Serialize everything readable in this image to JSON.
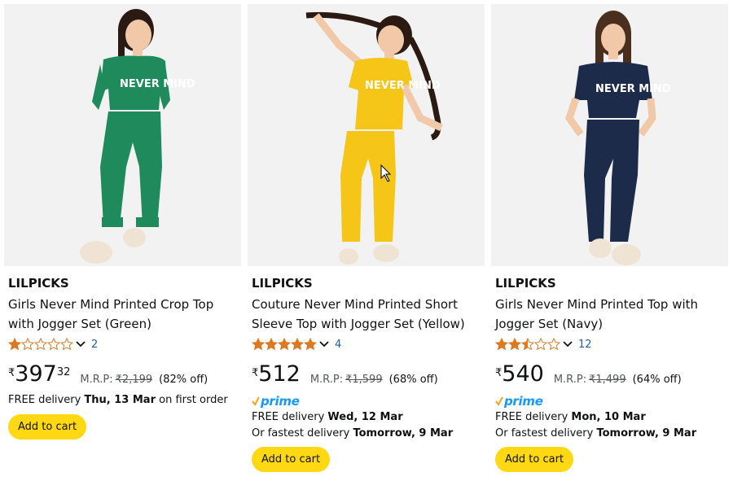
{
  "accent_colors": {
    "star": "#de7921",
    "link": "#2162a1",
    "button": "#ffd814",
    "prime": "#1399ff"
  },
  "products": [
    {
      "brand": "LILPICKS",
      "title": "Girls Never Mind Printed Crop Top with Jogger Set (Green)",
      "rating": 1,
      "rating_count": "2",
      "currency": "₹",
      "price_whole": "397",
      "price_fraction": "32",
      "mrp_label": "M.R.P:",
      "mrp": "₹2,199",
      "discount": "(82% off)",
      "prime": false,
      "delivery_prefix": "FREE delivery ",
      "delivery_date": "Thu, 13 Mar",
      "delivery_suffix": " on first order",
      "add_to_cart": "Add to cart",
      "outfit_color": "#1f8a5c",
      "print_text": "NEVER MIND"
    },
    {
      "brand": "LILPICKS",
      "title": "Couture Never Mind Printed Short Sleeve Top with Jogger Set (Yellow)",
      "rating": 5,
      "rating_count": "4",
      "currency": "₹",
      "price_whole": "512",
      "price_fraction": "",
      "mrp_label": "M.R.P:",
      "mrp": "₹1,599",
      "discount": "(68% off)",
      "prime": true,
      "prime_label": "prime",
      "delivery_prefix": "FREE delivery ",
      "delivery_date": "Wed, 12 Mar",
      "fastest_prefix": "Or fastest delivery ",
      "fastest_date": "Tomorrow, 9 Mar",
      "add_to_cart": "Add to cart",
      "outfit_color": "#f5c518",
      "print_text": "NEVER MIND"
    },
    {
      "brand": "LILPICKS",
      "title": "Girls Never Mind Printed Top with Jogger Set (Navy)",
      "rating": 2.5,
      "rating_count": "12",
      "currency": "₹",
      "price_whole": "540",
      "price_fraction": "",
      "mrp_label": "M.R.P:",
      "mrp": "₹1,499",
      "discount": "(64% off)",
      "prime": true,
      "prime_label": "prime",
      "delivery_prefix": "FREE delivery ",
      "delivery_date": "Mon, 10 Mar",
      "fastest_prefix": "Or fastest delivery ",
      "fastest_date": "Tomorrow, 9 Mar",
      "add_to_cart": "Add to cart",
      "outfit_color": "#1c2b4a",
      "print_text": "NEVER MIND"
    }
  ]
}
